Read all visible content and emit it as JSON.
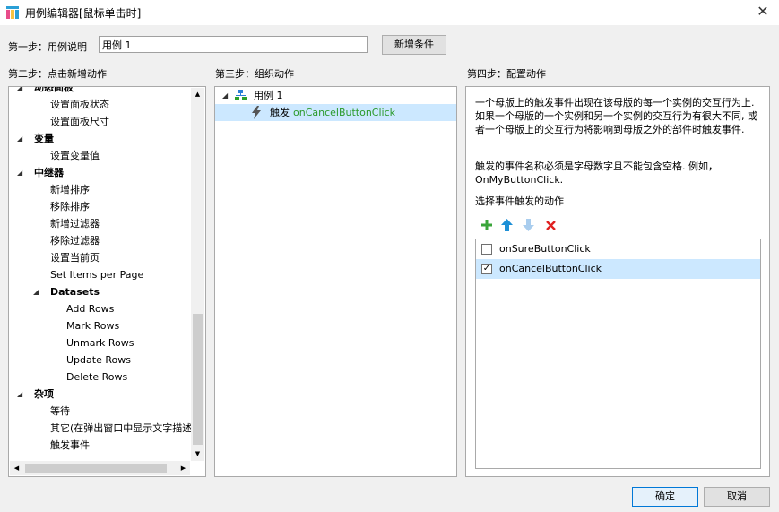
{
  "window": {
    "title": "用例编辑器[鼠标单击时]"
  },
  "step1": {
    "label": "第一步：用例说明",
    "value": "用例 1",
    "add_condition": "新增条件"
  },
  "step2": {
    "label": "第二步：点击新增动作",
    "items": [
      {
        "text": "动态面板",
        "kind": "group"
      },
      {
        "text": "设置面板状态",
        "kind": "item"
      },
      {
        "text": "设置面板尺寸",
        "kind": "item"
      },
      {
        "text": "变量",
        "kind": "group"
      },
      {
        "text": "设置变量值",
        "kind": "item"
      },
      {
        "text": "中继器",
        "kind": "group"
      },
      {
        "text": "新增排序",
        "kind": "item"
      },
      {
        "text": "移除排序",
        "kind": "item"
      },
      {
        "text": "新增过滤器",
        "kind": "item"
      },
      {
        "text": "移除过滤器",
        "kind": "item"
      },
      {
        "text": "设置当前页",
        "kind": "item"
      },
      {
        "text": "Set Items per Page",
        "kind": "item"
      },
      {
        "text": "Datasets",
        "kind": "subgroup"
      },
      {
        "text": "Add Rows",
        "kind": "subitem"
      },
      {
        "text": "Mark Rows",
        "kind": "subitem"
      },
      {
        "text": "Unmark Rows",
        "kind": "subitem"
      },
      {
        "text": "Update Rows",
        "kind": "subitem"
      },
      {
        "text": "Delete Rows",
        "kind": "subitem"
      },
      {
        "text": "杂项",
        "kind": "group"
      },
      {
        "text": "等待",
        "kind": "item"
      },
      {
        "text": "其它(在弹出窗口中显示文字描述)",
        "kind": "item"
      },
      {
        "text": "触发事件",
        "kind": "item"
      }
    ]
  },
  "step3": {
    "label": "第三步：组织动作",
    "case_name": "用例 1",
    "action_prefix": "触发",
    "action_event": "onCancelButtonClick"
  },
  "step4": {
    "label": "第四步：配置动作",
    "desc1": "一个母版上的触发事件出现在该母版的每一个实例的交互行为上. 如果一个母版的一个实例和另一个实例的交互行为有很大不同, 或者一个母版上的交互行为将影响到母版之外的部件时触发事件.",
    "desc2": "触发的事件名称必须是字母数字且不能包含空格. 例如，OnMyButtonClick.",
    "choose_label": "选择事件触发的动作",
    "events": [
      {
        "name": "onSureButtonClick",
        "checked": false
      },
      {
        "name": "onCancelButtonClick",
        "checked": true
      }
    ]
  },
  "footer": {
    "ok": "确定",
    "cancel": "取消"
  }
}
